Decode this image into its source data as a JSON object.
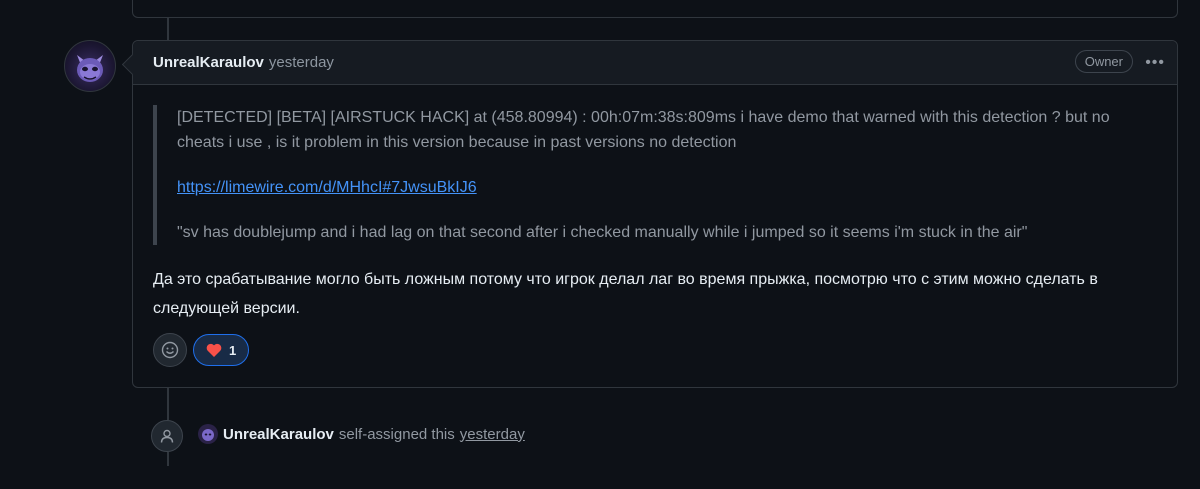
{
  "comment": {
    "author": "UnrealKaraulov",
    "timestamp": "yesterday",
    "badge": "Owner",
    "quote_paragraph_1": "[DETECTED] [BETA] [AIRSTUCK HACK] at (458.80994) : 00h:07m:38s:809ms i have demo that warned with this detection ? but no cheats i use , is it problem in this version because in past versions no detection",
    "quote_link": "https://limewire.com/d/MHhcI#7JwsuBkIJ6",
    "quote_paragraph_3": "\"sv has doublejump and i had lag on that second after i checked manually while i jumped so it seems i'm stuck in the air\"",
    "answer": "Да это срабатывание могло быть ложным потому что игрок делал лаг во время прыжка, посмотрю что с этим можно сделать в следующей версии.",
    "reactions": [
      {
        "icon": "heart-icon",
        "count": "1"
      }
    ]
  },
  "event": {
    "actor": "UnrealKaraulov",
    "action": "self-assigned this",
    "time": "yesterday"
  },
  "colors": {
    "background": "#0d1117",
    "header": "#161b22",
    "border": "#30363d",
    "link": "#4493f8",
    "muted": "#9198a1",
    "heart": "#f85149"
  }
}
